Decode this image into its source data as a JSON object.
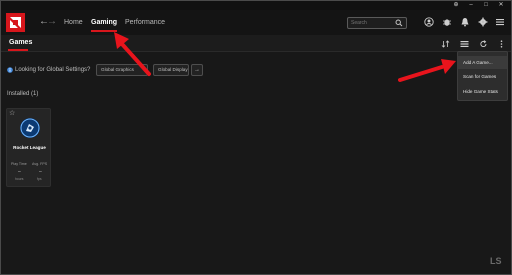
{
  "window": {
    "controls": [
      "⊕",
      "–",
      "□",
      "✕"
    ]
  },
  "nav": {
    "back_icon": "arrow-left-icon",
    "forward_icon": "arrow-right-icon",
    "tabs": [
      {
        "label": "Home",
        "active": false
      },
      {
        "label": "Gaming",
        "active": true
      },
      {
        "label": "Performance",
        "active": false
      }
    ],
    "search_placeholder": "Search",
    "icons": [
      "user-icon",
      "bug-icon",
      "bell-icon",
      "gear-icon",
      "menu-icon"
    ]
  },
  "subheader": {
    "title": "Games",
    "icons": [
      "sort-icon",
      "list-view-icon",
      "refresh-icon",
      "more-vertical-icon"
    ]
  },
  "global": {
    "label": "Looking for Global Settings?",
    "graphics_button": "Global Graphics",
    "display_button": "Global Display"
  },
  "installed": {
    "label": "Installed (1)"
  },
  "game_card": {
    "name": "Rocket League",
    "stats": [
      {
        "label": "Play Time",
        "value": "–",
        "unit": "hours"
      },
      {
        "label": "Avg. FPS",
        "value": "–",
        "unit": "fps"
      }
    ]
  },
  "dropdown": {
    "items": [
      "Add A Game...",
      "Scan for Games",
      "Hide Game Stats"
    ]
  },
  "watermark": {
    "text": "LS"
  },
  "colors": {
    "accent": "#d7161c",
    "annotation": "#e8141c",
    "background": "#181818"
  }
}
